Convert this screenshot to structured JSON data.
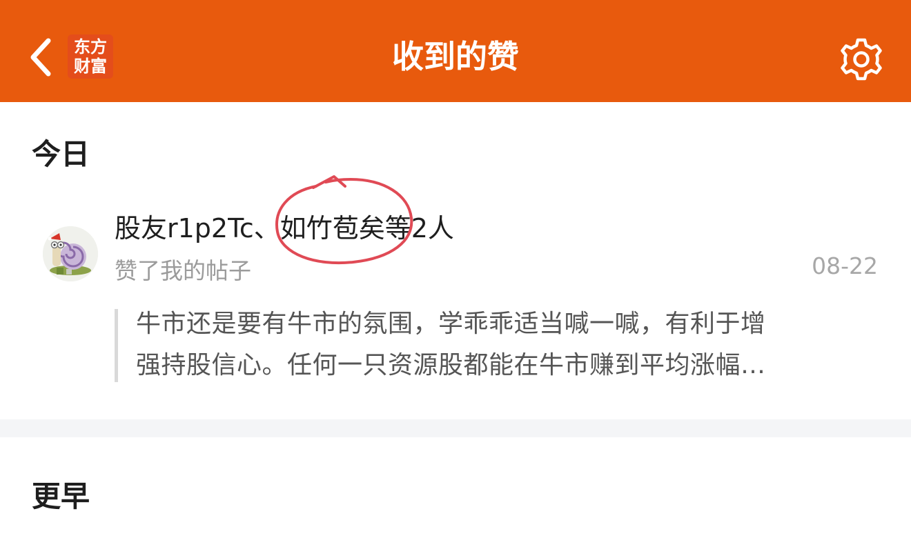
{
  "header": {
    "title": "收到的赞",
    "logo_line1": "东方",
    "logo_line2": "财富",
    "back_icon": "chevron-left-icon",
    "settings_icon": "gear-icon",
    "color": "#e85a0d"
  },
  "sections": {
    "today": "今日",
    "earlier": "更早"
  },
  "notification": {
    "users": "股友r1p2Tc、如竹苞矣等2人",
    "action": "赞了我的帖子",
    "date": "08-22",
    "quote_line1": "牛市还是要有牛市的氛围，学乖乖适当喊一喊，有利于增",
    "quote_line2": "强持股信心。任何一只资源股都能在牛市赚到平均涨幅…"
  },
  "annotation": {
    "color": "#e04a55"
  }
}
